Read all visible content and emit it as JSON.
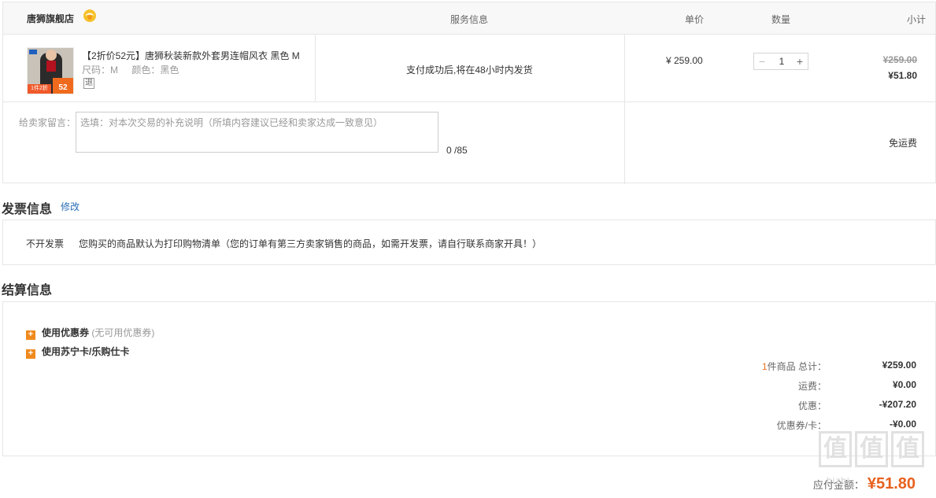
{
  "order": {
    "shop_name": "唐狮旗舰店",
    "headers": {
      "service": "服务信息",
      "unit_price": "单价",
      "quantity": "数量",
      "subtotal": "小计"
    },
    "item": {
      "title": "【2折价52元】唐狮秋装新款外套男连帽风衣 黑色 M",
      "size": "尺码：M",
      "color": "颜色：黑色",
      "return_badge": "退",
      "thumb_tag_left": "1件2折",
      "thumb_tag_right": "52",
      "service_info": "支付成功后,将在48小时内发货",
      "unit_price": "¥ 259.00",
      "qty_minus": "−",
      "quantity": "1",
      "qty_plus": "+",
      "original_subtotal": "¥259.00",
      "subtotal": "¥51.80"
    },
    "message": {
      "label": "给卖家留言：",
      "placeholder": "选填：对本次交易的补充说明（所填内容建议已经和卖家达成一致意见）",
      "count": "0 /85"
    },
    "shipping_note": "免运费"
  },
  "invoice": {
    "title": "发票信息",
    "edit_label": "修改",
    "type": "不开发票",
    "description": "您购买的商品默认为打印购物清单（您的订单有第三方卖家销售的商品，如需开发票，请自行联系商家开具！）"
  },
  "settlement": {
    "title": "结算信息",
    "coupon_label": "使用优惠券",
    "coupon_note": "(无可用优惠券)",
    "card_label": "使用苏宁卡/乐购仕卡",
    "rows": [
      {
        "count": "1",
        "label": "件商品 总计：",
        "value": "¥259.00"
      },
      {
        "label": "运费：",
        "value": "¥0.00"
      },
      {
        "label": "优惠：",
        "value": "-¥207.20"
      },
      {
        "label": "优惠券/卡：",
        "value": "-¥0.00"
      }
    ],
    "payable_label": "应付金额：",
    "payable_value": "¥51.80"
  },
  "watermark": {
    "glyph": "值",
    "site": "bizhi"
  }
}
